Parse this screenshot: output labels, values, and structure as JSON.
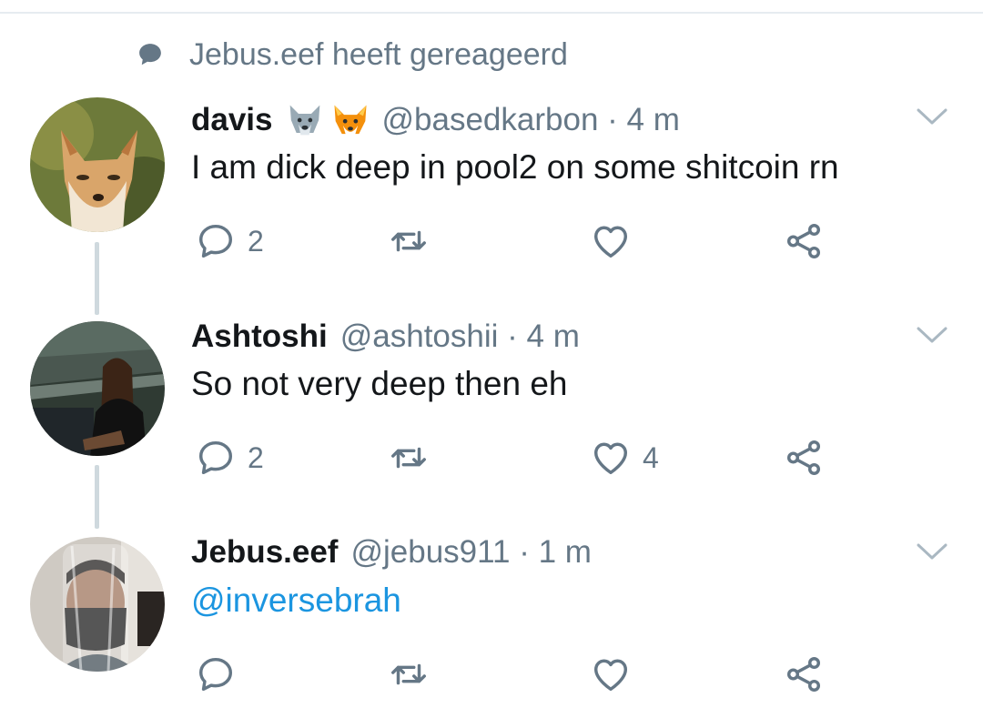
{
  "reply_context": {
    "text": "Jebus.eef heeft gereageerd",
    "icon": "speech-bubble-icon"
  },
  "colors": {
    "text": "#14171a",
    "muted": "#657786",
    "link": "#1b95e0",
    "line": "#cfd9de"
  },
  "tweets": [
    {
      "name": "davis",
      "handle_time": "@basedkarbon · 4 m",
      "text": "I am dick deep in pool2 on some shitcoin rn",
      "is_mention": false,
      "emojis": [
        "wolf-emoji",
        "fox-emoji"
      ],
      "replies": "2",
      "retweets": "",
      "likes": ""
    },
    {
      "name": "Ashtoshi",
      "handle_time": "@ashtoshii · 4 m",
      "text": "So not very deep then eh",
      "is_mention": false,
      "replies": "2",
      "retweets": "",
      "likes": "4"
    },
    {
      "name": "Jebus.eef",
      "handle_time": "@jebus911 · 1 m",
      "text": "@inversebrah",
      "is_mention": true,
      "replies": "",
      "retweets": "",
      "likes": ""
    }
  ]
}
